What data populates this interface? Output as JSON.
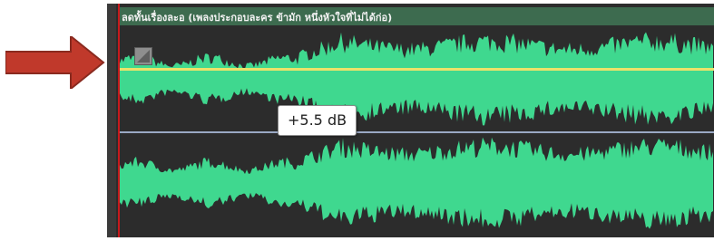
{
  "clip": {
    "title": "ลดทั้นเรื่องละอ (เพลงประกอบละคร ข้ามัก หนึ่งหัวใจที่ไม่ได้ก่อ)",
    "volume_tooltip": "+5.5 dB"
  },
  "annotation": {
    "arrow_color": "#c0392b"
  },
  "colors": {
    "waveform": "#3fd88f",
    "track_background": "#2c2c2c",
    "volume_envelope": "#ece36a",
    "center_line": "#9aa8c4",
    "playhead": "#c8191c"
  },
  "icons": {
    "fade_handle": "fade-in-handle-icon",
    "arrow": "arrow-right-icon"
  }
}
